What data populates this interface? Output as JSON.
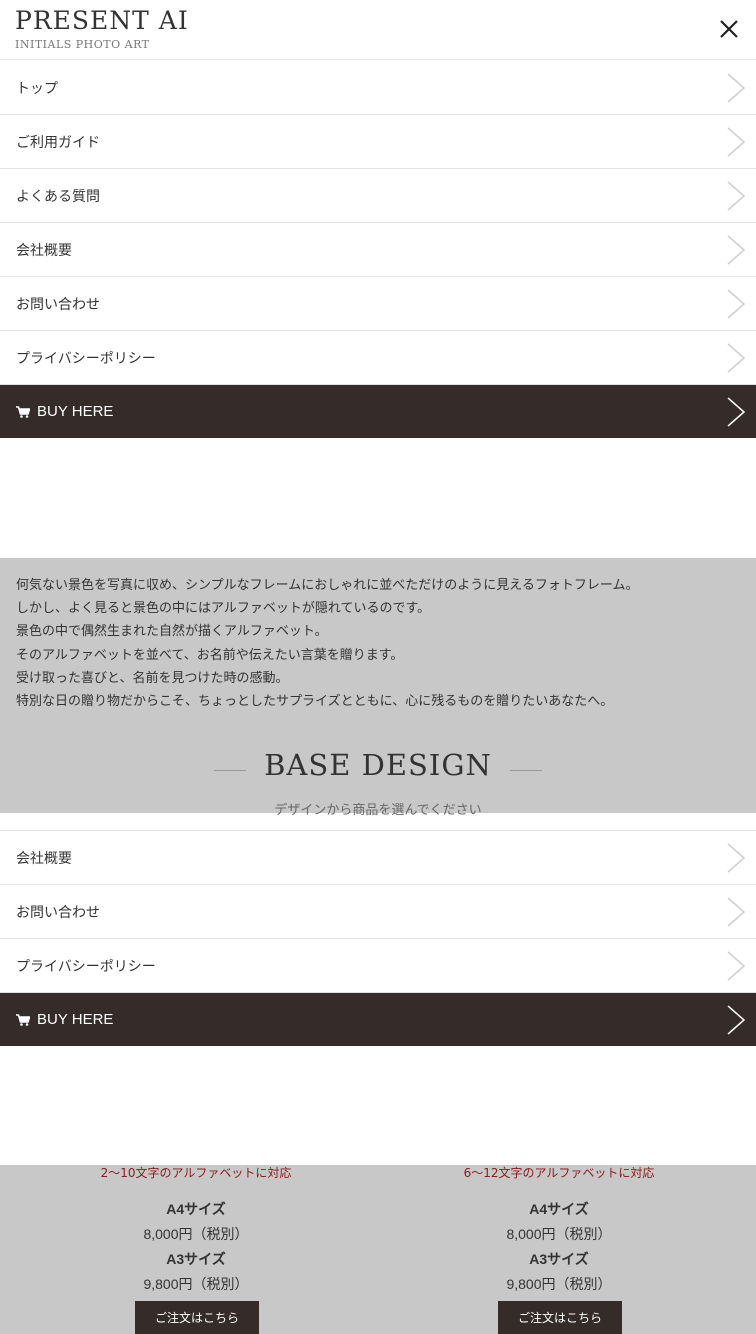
{
  "header": {
    "logo_title": "PRESENT AI",
    "logo_subtitle": "INITIALS PHOTO ART"
  },
  "menu_top": {
    "items": [
      "トップ",
      "ご利用ガイド",
      "よくある質問",
      "会社概要",
      "お問い合わせ",
      "プライバシーポリシー"
    ],
    "buy_label": "BUY HERE"
  },
  "intro": {
    "lines": [
      "何気ない景色を写真に収め、シンプルなフレームにおしゃれに並べただけのように見えるフォトフレーム。",
      "しかし、よく見ると景色の中にはアルファベットが隠れているのです。",
      "景色の中で偶然生まれた自然が描くアルファベット。",
      "そのアルファベットを並べて、お名前や伝えたい言葉を贈ります。",
      "受け取った喜びと、名前を見つけた時の感動。",
      "特別な日の贈り物だからこそ、ちょっとしたサプライズとともに、心に残るものを贈りたいあなたへ。"
    ]
  },
  "base_design": {
    "title": "BASE DESIGN",
    "subtitle": "デザインから商品を選んでください"
  },
  "menu_bottom": {
    "items": [
      "会社概要",
      "お問い合わせ",
      "プライバシーポリシー"
    ],
    "buy_label": "BUY HERE"
  },
  "products": [
    {
      "note": "2〜10文字のアルファベットに対応",
      "size_a4": "A4サイズ",
      "price_a4": "8,000円（税別）",
      "size_a3": "A3サイズ",
      "price_a3": "9,800円（税別）",
      "order_label": "ご注文はこちら"
    },
    {
      "note": "6〜12文字のアルファベットに対応",
      "size_a4": "A4サイズ",
      "price_a4": "8,000円（税別）",
      "size_a3": "A3サイズ",
      "price_a3": "9,800円（税別）",
      "order_label": "ご注文はこちら"
    }
  ],
  "colors": {
    "buy_bar": "#352b28",
    "band": "#c8c8c8",
    "note_red": "#8a1a1a"
  }
}
